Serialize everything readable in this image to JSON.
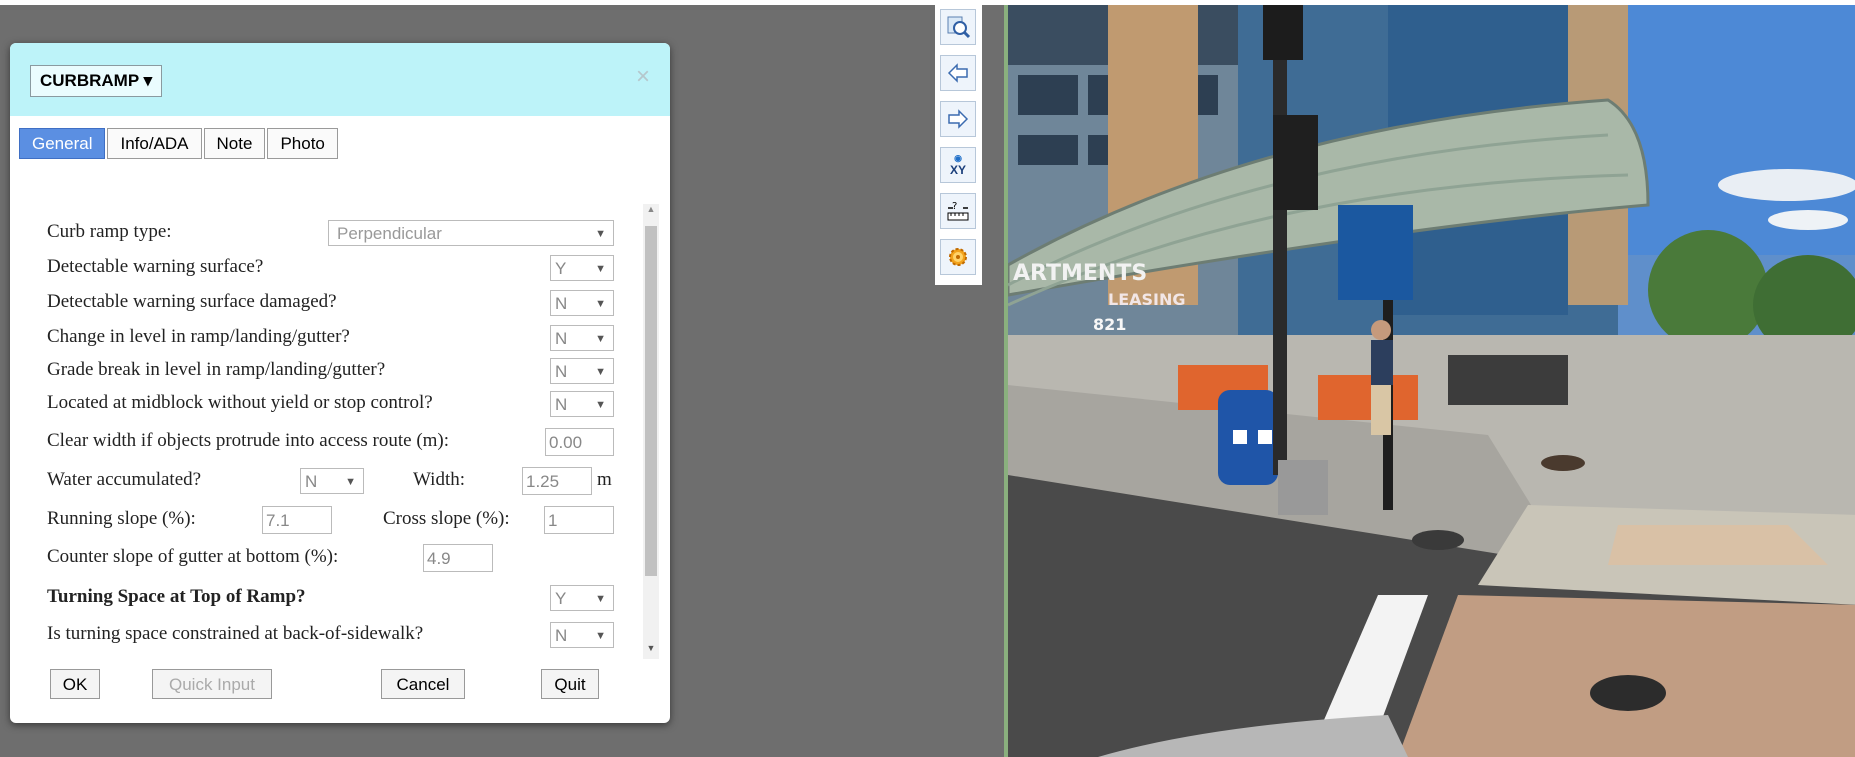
{
  "dialog": {
    "layer_dropdown": "CURBRAMP ▾",
    "close": "×",
    "tabs": [
      "General",
      "Info/ADA",
      "Note",
      "Photo"
    ],
    "fields": {
      "curb_ramp_type": {
        "label": "Curb ramp type:",
        "value": "Perpendicular"
      },
      "dws": {
        "label": "Detectable warning surface?",
        "value": "Y"
      },
      "dws_damaged": {
        "label": "Detectable warning surface damaged?",
        "value": "N"
      },
      "change_level": {
        "label": "Change in level in ramp/landing/gutter?",
        "value": "N"
      },
      "grade_break": {
        "label": "Grade break in level in ramp/landing/gutter?",
        "value": "N"
      },
      "midblock": {
        "label": "Located at midblock without yield or stop control?",
        "value": "N"
      },
      "clear_width": {
        "label": "Clear width if objects protrude into access route (m):",
        "value": "0.00"
      },
      "water": {
        "label": "Water accumulated?",
        "value": "N"
      },
      "width": {
        "label": "Width:",
        "value": "1.25",
        "unit": "m"
      },
      "running_slope": {
        "label": "Running slope (%):",
        "value": "7.1"
      },
      "cross_slope": {
        "label": "Cross slope (%):",
        "value": "1"
      },
      "counter_slope": {
        "label": "Counter slope of gutter at bottom (%):",
        "value": "4.9"
      },
      "turning_space": {
        "label": "Turning Space at Top of Ramp?",
        "value": "Y"
      },
      "turning_constrained": {
        "label": "Is turning space constrained at back-of-sidewalk?",
        "value": "N"
      }
    },
    "buttons": {
      "ok": "OK",
      "quick_input": "Quick Input",
      "cancel": "Cancel",
      "quit": "Quit"
    }
  },
  "toolbar": {
    "icons": [
      "zoom-photo-icon",
      "previous-arrow-icon",
      "next-arrow-icon",
      "xy-coordinate-icon",
      "measure-icon",
      "settings-gear-icon"
    ],
    "xy_label": "XY"
  },
  "photo": {
    "sign_text": "ARTMENTS",
    "leasing_text": "LEASING",
    "phone_fragment": "821"
  }
}
